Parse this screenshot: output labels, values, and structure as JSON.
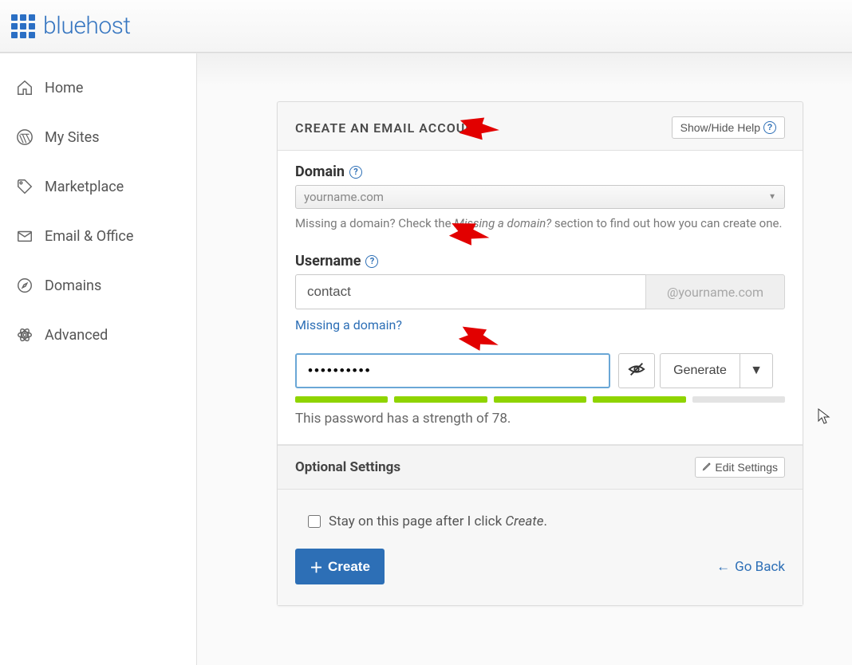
{
  "brand": {
    "name": "bluehost"
  },
  "sidebar": {
    "items": [
      {
        "label": "Home"
      },
      {
        "label": "My Sites"
      },
      {
        "label": "Marketplace"
      },
      {
        "label": "Email & Office"
      },
      {
        "label": "Domains"
      },
      {
        "label": "Advanced"
      }
    ]
  },
  "panel": {
    "title": "CREATE AN EMAIL ACCOUNT",
    "help_button": "Show/Hide Help",
    "domain": {
      "label": "Domain",
      "selected": "yourname.com",
      "hint_pre": "Missing a domain? Check the ",
      "hint_em": "Missing a domain?",
      "hint_post": " section to find out how you can create one."
    },
    "username": {
      "label": "Username",
      "value": "contact",
      "suffix": "@yourname.com",
      "missing_link": "Missing a domain?"
    },
    "password": {
      "value": "••••••••••",
      "generate_label": "Generate",
      "strength_text": "This password has a strength of 78.",
      "strength_score": 78
    },
    "optional": {
      "title": "Optional Settings",
      "edit_label": "Edit Settings"
    },
    "footer": {
      "stay_label_pre": "Stay on this page after I click ",
      "stay_label_em": "Create",
      "stay_label_post": ".",
      "create_label": "Create",
      "go_back_label": "Go Back"
    }
  }
}
